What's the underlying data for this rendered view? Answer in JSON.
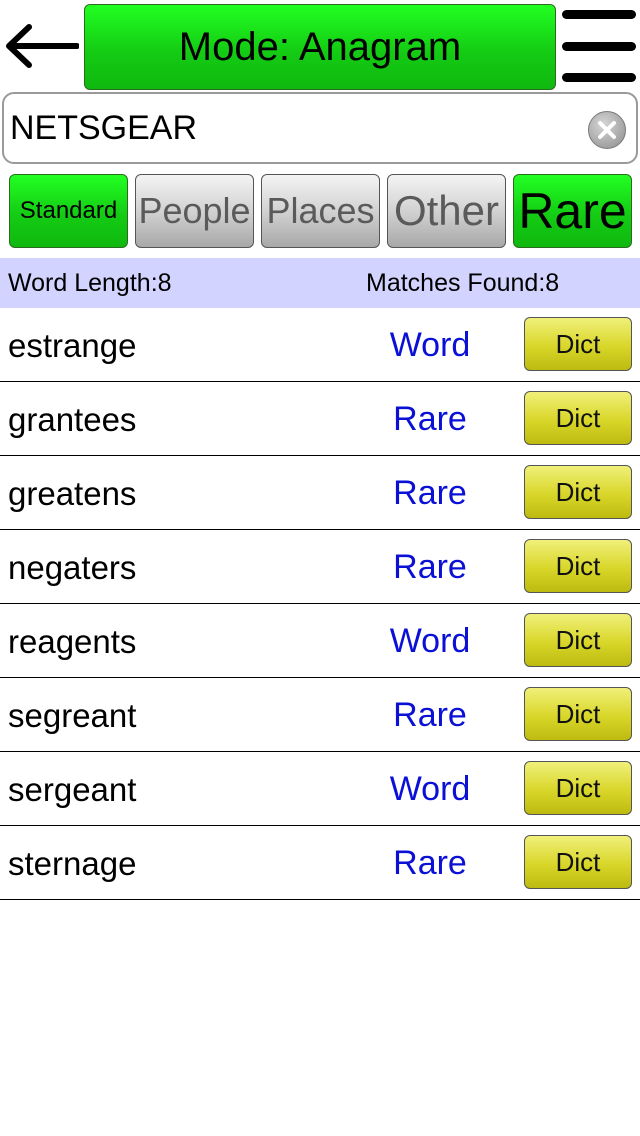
{
  "header": {
    "mode_label": "Mode: Anagram",
    "back_icon": "left-arrow-icon",
    "menu_icon": "hamburger-menu-icon"
  },
  "search": {
    "value": "NETSGEAR",
    "clear_icon": "clear-icon"
  },
  "filters": [
    {
      "label": "Standard",
      "active": true
    },
    {
      "label": "People",
      "active": false
    },
    {
      "label": "Places",
      "active": false
    },
    {
      "label": "Other",
      "active": false
    },
    {
      "label": "Rare",
      "active": true
    }
  ],
  "info": {
    "word_length": "Word Length:8",
    "matches_found": "Matches Found:8"
  },
  "results": [
    {
      "word": "estrange",
      "type": "Word",
      "dict_label": "Dict"
    },
    {
      "word": "grantees",
      "type": "Rare",
      "dict_label": "Dict"
    },
    {
      "word": "greatens",
      "type": "Rare",
      "dict_label": "Dict"
    },
    {
      "word": "negaters",
      "type": "Rare",
      "dict_label": "Dict"
    },
    {
      "word": "reagents",
      "type": "Word",
      "dict_label": "Dict"
    },
    {
      "word": "segreant",
      "type": "Rare",
      "dict_label": "Dict"
    },
    {
      "word": "sergeant",
      "type": "Word",
      "dict_label": "Dict"
    },
    {
      "word": "sternage",
      "type": "Rare",
      "dict_label": "Dict"
    }
  ],
  "colors": {
    "mode_green": "#14cc14",
    "info_bar": "#d2d3ff",
    "type_blue": "#0a10d6",
    "dict_yellow": "#d8d628"
  }
}
